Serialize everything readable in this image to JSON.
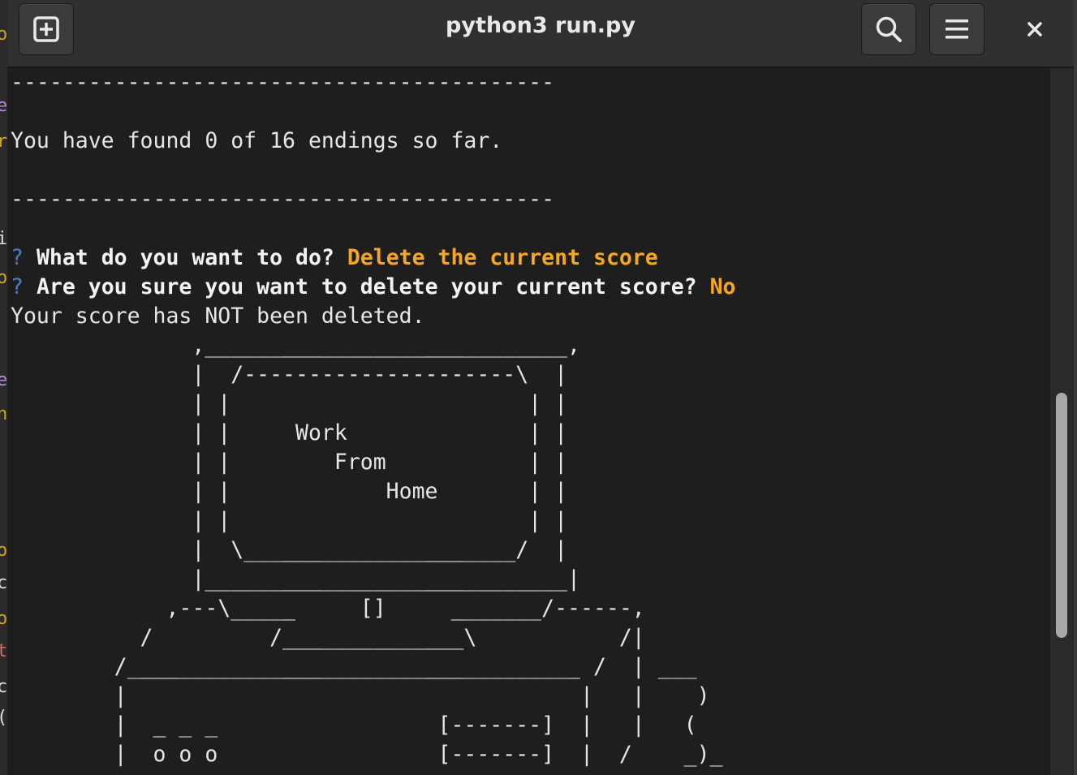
{
  "window": {
    "title": "python3 run.py"
  },
  "headerbar": {
    "new_tab_icon": "plus-square-icon",
    "search_icon": "search-icon",
    "menu_icon": "hamburger-menu-icon",
    "close_icon": "close-icon"
  },
  "terminal": {
    "separator_top": "------------------------------------------",
    "endings_text": "You have found 0 of 16 endings so far.",
    "separator_bottom": "------------------------------------------",
    "prompt1": {
      "mark": "?",
      "question": "What do you want to do?",
      "answer": "Delete the current score"
    },
    "prompt2": {
      "mark": "?",
      "question": "Are you sure you want to delete your current score?",
      "answer": "No"
    },
    "result_text": "Your score has NOT been deleted.",
    "ascii_art": [
      "              ,____________________________,",
      "              |  /---------------------\\  |",
      "              | |                       | |",
      "              | |     Work              | |",
      "              | |        From           | |",
      "              | |            Home       | |",
      "              | |                       | |",
      "              |  \\_____________________/  |",
      "              |____________________________|",
      "            ,---\\_____     []     _______/------,",
      "          /         /______________\\           /|",
      "        /___________________________________ /  | ___",
      "        |                                   |   |    )",
      "        |  _ _ _                 [-------]  |   |   (",
      "        |  o o o                 [-------]  |  /    _)_"
    ]
  },
  "colors": {
    "background": "#1e1e1e",
    "headerbar": "#303030",
    "text": "#e6e6e6",
    "answer": "#f5a623",
    "question_mark": "#4a7fc4"
  }
}
